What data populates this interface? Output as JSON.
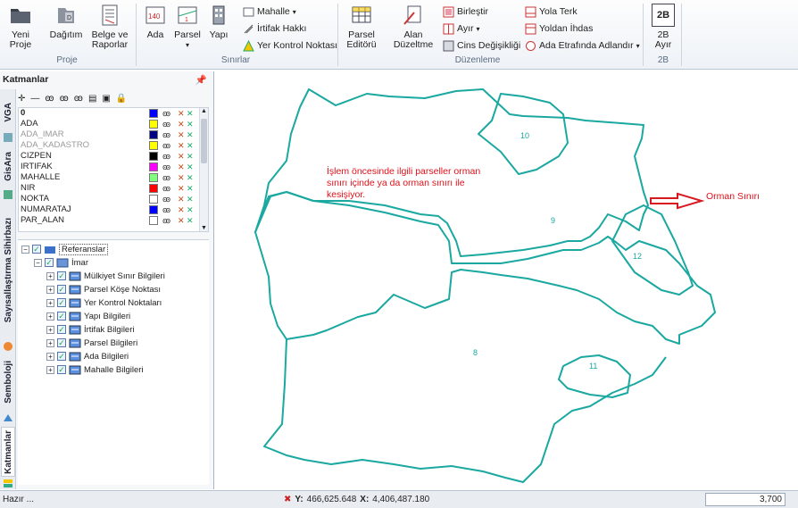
{
  "ribbon": {
    "proje": {
      "yeni": "Yeni\nProje",
      "dagitim": "Dağıtım",
      "belge": "Belge ve\nRaporlar",
      "group": "Proje"
    },
    "sinirlar": {
      "ada": "Ada",
      "parsel": "Parsel",
      "yapi": "Yapı",
      "mahalle": "Mahalle",
      "irtifak": "İrtifak Hakkı",
      "ykn": "Yer Kontrol Noktası",
      "group": "Sınırlar"
    },
    "duzenleme": {
      "parsel_editoru": "Parsel\nEditörü",
      "alan_duzeltme": "Alan\nDüzeltme",
      "birlestir": "Birleştir",
      "ayir": "Ayır",
      "cins": "Cins Değişikliği",
      "yola_terk": "Yola Terk",
      "yoldan_ihdas": "Yoldan İhdas",
      "ada_etrafinda": "Ada Etrafında Adlandır",
      "group": "Düzenleme"
    },
    "b2": {
      "ayir": "2B\nAyır",
      "group": "2B",
      "icon_text": "2B"
    }
  },
  "panel": {
    "title": "Katmanlar",
    "vtabs": [
      "VGA",
      "GisAra",
      "Sayısallaştırma Sihirbazı",
      "Semboloji",
      "Katmanlar"
    ],
    "layers": [
      {
        "name": "0",
        "color": "#0000ff",
        "dim": false
      },
      {
        "name": "ADA",
        "color": "#ffff00",
        "dim": false
      },
      {
        "name": "ADA_IMAR",
        "color": "#000080",
        "dim": true
      },
      {
        "name": "ADA_KADASTRO",
        "color": "#ffff00",
        "dim": true
      },
      {
        "name": "CIZPEN",
        "color": "#000000",
        "dim": false
      },
      {
        "name": "IRTIFAK",
        "color": "#ff00ff",
        "dim": false
      },
      {
        "name": "MAHALLE",
        "color": "#80ff80",
        "dim": false
      },
      {
        "name": "NIR",
        "color": "#ff0000",
        "dim": false
      },
      {
        "name": "NOKTA",
        "color": "#ffffff",
        "dim": false
      },
      {
        "name": "NUMARATAJ",
        "color": "#0000ff",
        "dim": false
      },
      {
        "name": "PAR_ALAN",
        "color": "#ffffff",
        "dim": false
      }
    ],
    "tree": {
      "root": "Referanslar",
      "imar": "İmar",
      "items": [
        "Mülkiyet Sınır Bilgileri",
        "Parsel Köşe Noktası",
        "Yer Kontrol Noktaları",
        "Yapı Bilgileri",
        "İrtifak Bilgileri",
        "Parsel Bilgileri",
        "Ada Bilgileri",
        "Mahalle Bilgileri"
      ]
    }
  },
  "map": {
    "annotation": "İşlem öncesinde ilgili parseller orman\nsınırı içinde ya da orman sınırı ile\nkesişiyor.",
    "orman_label": "Orman Sınırı",
    "parcel_labels": [
      "10",
      "9",
      "12",
      "8",
      "11"
    ],
    "colors": {
      "boundary": "#1aa8a0",
      "annotation": "#e0101a"
    }
  },
  "status": {
    "ready": "Hazır ...",
    "y_label": "Y:",
    "y_value": "466,625.648",
    "x_label": "X:",
    "x_value": "4,406,487.180",
    "scale": "3,700"
  }
}
